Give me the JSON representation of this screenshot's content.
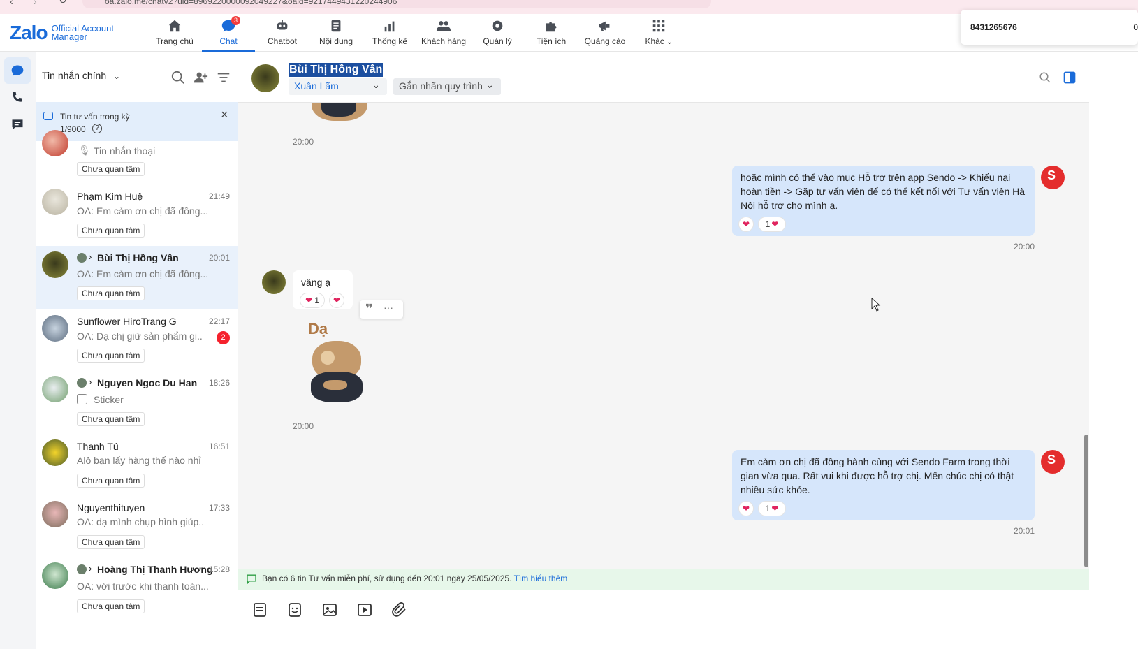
{
  "browser": {
    "url": "oa.zalo.me/chatv2?uid=8969220000092049227&oaid=9217449431220244906"
  },
  "nav": {
    "logo": {
      "brand": "Zalo",
      "line1": "Official Account",
      "line2": "Manager"
    },
    "items": [
      {
        "label": "Trang chủ",
        "icon": "home-icon"
      },
      {
        "label": "Chat",
        "icon": "chat-icon",
        "badge": "3"
      },
      {
        "label": "Chatbot",
        "icon": "robot-icon"
      },
      {
        "label": "Nội dung",
        "icon": "document-icon"
      },
      {
        "label": "Thống kê",
        "icon": "bar-chart-icon"
      },
      {
        "label": "Khách hàng",
        "icon": "users-icon"
      },
      {
        "label": "Quản lý",
        "icon": "gear-icon"
      },
      {
        "label": "Tiện ích",
        "icon": "puzzle-icon"
      },
      {
        "label": "Quảng cáo",
        "icon": "megaphone-icon"
      },
      {
        "label": "Khác",
        "icon": "grid-icon"
      }
    ],
    "phone_popup": {
      "number": "8431265676",
      "tail": "0"
    }
  },
  "list": {
    "title": "Tin nhắn chính",
    "banner": {
      "title": "Tin tư vấn trong kỳ",
      "count": "1/9000"
    },
    "conversations": [
      {
        "name": "",
        "preview": "Tin nhắn thoại",
        "time": "",
        "tag": "Chưa quan tâm"
      },
      {
        "name": "Phạm Kim Huệ",
        "preview": "Em cảm ơn chị đã đồng...",
        "prefix": "OA:",
        "time": "21:49",
        "tag": "Chưa quan tâm"
      },
      {
        "name": "Bùi Thị Hồng Vân",
        "preview": "Em cảm ơn chị đã đồng...",
        "prefix": "OA:",
        "time": "20:01",
        "tag": "Chưa quan tâm"
      },
      {
        "name": "Sunflower HiroTrang G",
        "preview": "Dạ chị giữ sản phẩm gi...",
        "prefix": "OA:",
        "time": "22:17",
        "tag": "Chưa quan tâm",
        "unread": "2"
      },
      {
        "name": "Nguyen Ngoc Du Han",
        "preview": "Sticker",
        "time": "18:26",
        "tag": "Chưa quan tâm"
      },
      {
        "name": "Thanh Tú",
        "preview": "Alô bạn lấy hàng thế nào nhỉ",
        "time": "16:51",
        "tag": "Chưa quan tâm"
      },
      {
        "name": "Nguyenthituyen",
        "preview": "dạ mình chụp hình giúp...",
        "prefix": "OA:",
        "time": "17:33",
        "tag": "Chưa quan tâm"
      },
      {
        "name": "Hoàng Thị Thanh Hương",
        "preview": "với trước khi thanh toán...",
        "prefix": "OA:",
        "time": "15:28",
        "tag": "Chưa quan tâm"
      }
    ]
  },
  "chat": {
    "header": {
      "name": "Bùi Thị Hồng Vân",
      "assignee": "Xuân Lãm",
      "label_select": "Gắn nhãn quy trình"
    },
    "messages": [
      {
        "time": "20:00"
      },
      {
        "text": "hoặc mình có thể vào mục Hỗ trợ trên app Sendo -> Khiếu nại hoàn tiền -> Gặp tư vấn viên để có thể kết nối với Tư vấn viên Hà Nội hỗ trợ cho mình ạ.",
        "react_count": "1",
        "time": "20:00"
      },
      {
        "text": "vâng ạ",
        "react_count": "1",
        "sticker_text": "Dạ",
        "time": "20:00"
      },
      {
        "text": "Em cảm ơn chị đã đồng hành cùng với Sendo Farm trong thời gian vừa qua. Rất vui khi được hỗ trợ chị. Mến chúc chị có thật nhiều sức khỏe.",
        "react_count": "1",
        "time": "20:01"
      }
    ],
    "notice": {
      "text": "Bạn có 6 tin Tư vấn miễn phí, sử dụng đến 20:01 ngày 25/05/2025.",
      "link": "Tìm hiểu thêm"
    }
  },
  "colors": {
    "accent": "#1a6bd9",
    "bubble_out": "#d6e6fb",
    "notice_bg": "#e7f7ea",
    "badge": "#f23d3d"
  }
}
